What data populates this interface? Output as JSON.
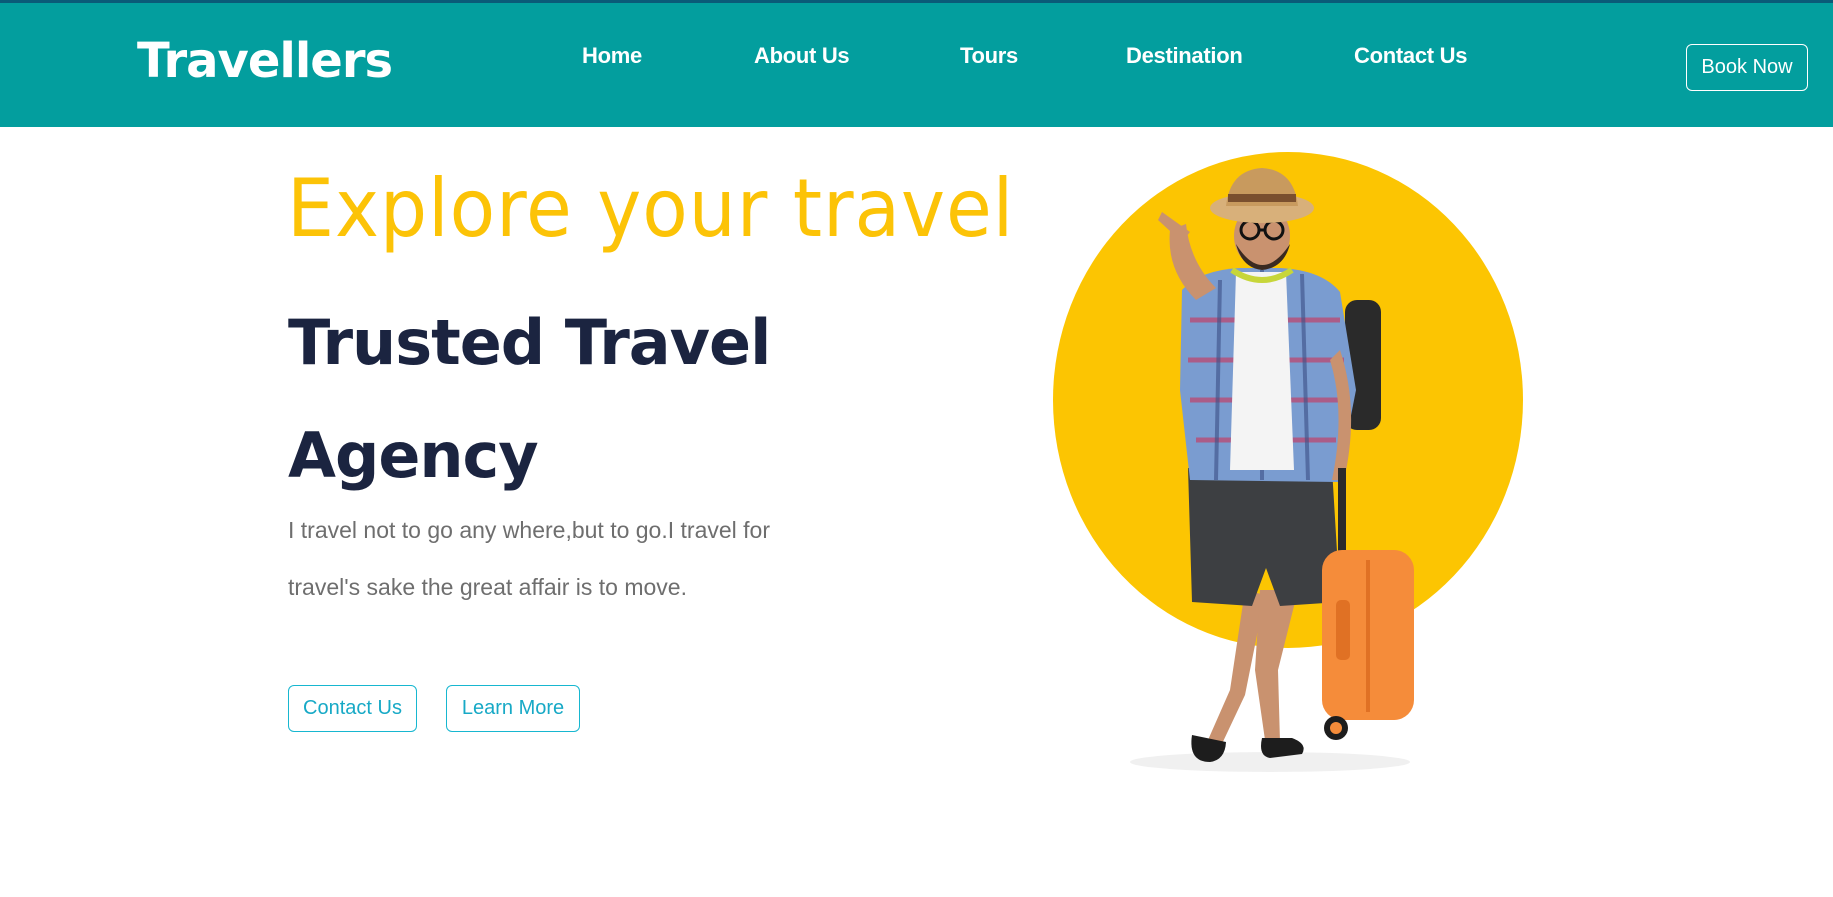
{
  "navbar": {
    "brand": "Travellers",
    "links": [
      "Home",
      "About Us",
      "Tours",
      "Destination",
      "Contact Us"
    ],
    "book_button": "Book Now"
  },
  "hero": {
    "tagline": "Explore your travel",
    "headline": "Trusted Travel Agency",
    "description": "I travel not to go any where,but to go.I travel for travel's sake the great affair is to move.",
    "buttons": {
      "contact": "Contact Us",
      "learn_more": "Learn More"
    },
    "image": "traveller-with-suitcase-illustration"
  },
  "colors": {
    "navbar_bg": "#039e9e",
    "accent_yellow": "#fcc307",
    "headline": "#1b2440",
    "button_outline": "#17b7d0"
  }
}
